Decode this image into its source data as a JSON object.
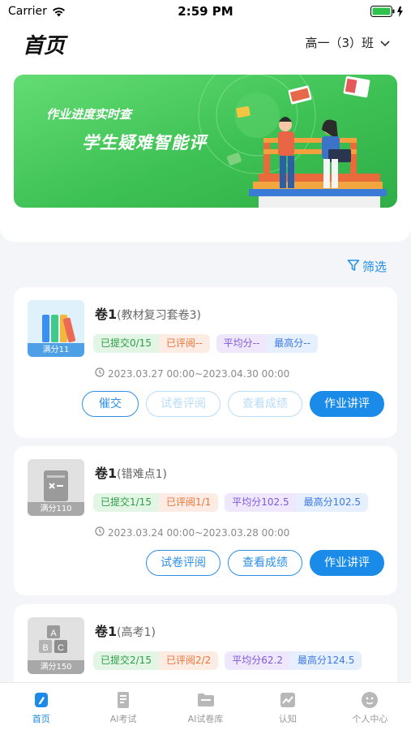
{
  "status_bar": {
    "carrier": "Carrier",
    "time": "2:59 PM"
  },
  "header": {
    "title": "首页",
    "class_label": "高一（3）班"
  },
  "banner": {
    "line1": "作业进度实时查",
    "line2": "学生疑难智能评"
  },
  "filter": {
    "label": "筛选"
  },
  "cards": [
    {
      "title": "卷1",
      "subtitle": "(教材复习套卷3)",
      "score_label": "满分11",
      "submitted": "已提交0/15",
      "reviewed": "已评阅--",
      "average": "平均分--",
      "highest": "最高分--",
      "time": "2023.03.27 00:00~2023.04.30 00:00",
      "buttons": [
        "催交",
        "试卷评阅",
        "查看成绩",
        "作业讲评"
      ]
    },
    {
      "title": "卷1",
      "subtitle": "(错难点1)",
      "score_label": "满分110",
      "submitted": "已提交1/15",
      "reviewed": "已评阅1/1",
      "average": "平均分102.5",
      "highest": "最高分102.5",
      "time": "2023.03.24 00:00~2023.03.28 00:00",
      "buttons": [
        "试卷评阅",
        "查看成绩",
        "作业讲评"
      ]
    },
    {
      "title": "卷1",
      "subtitle": "(高考1)",
      "score_label": "满分150",
      "submitted": "已提交2/15",
      "reviewed": "已评阅2/2",
      "average": "平均分62.2",
      "highest": "最高分124.5"
    }
  ],
  "tabs": [
    {
      "label": "首页",
      "icon": "home-icon"
    },
    {
      "label": "AI考试",
      "icon": "exam-icon"
    },
    {
      "label": "AI试卷库",
      "icon": "folder-icon"
    },
    {
      "label": "认知",
      "icon": "chart-icon"
    },
    {
      "label": "个人中心",
      "icon": "profile-icon"
    }
  ],
  "colors": {
    "accent": "#1a8be8",
    "banner_green": "#3ec154"
  }
}
